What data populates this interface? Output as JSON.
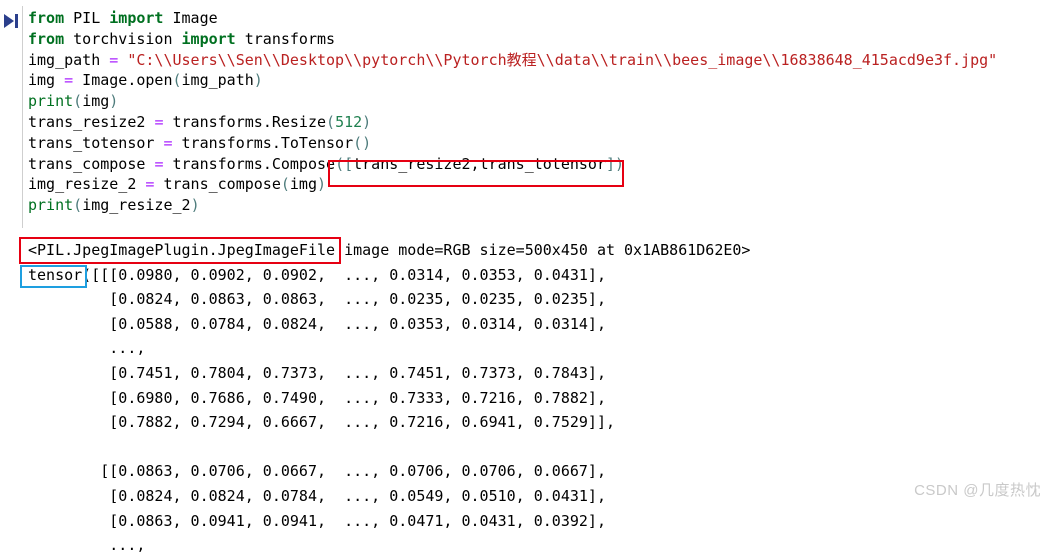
{
  "gutter": {
    "run_icon": "run-cell-icon"
  },
  "code": {
    "lines": [
      [
        {
          "t": "from",
          "c": "kw"
        },
        {
          "t": " PIL ",
          "c": "plain"
        },
        {
          "t": "import",
          "c": "kw"
        },
        {
          "t": " Image",
          "c": "plain"
        }
      ],
      [
        {
          "t": "from",
          "c": "kw"
        },
        {
          "t": " torchvision ",
          "c": "plain"
        },
        {
          "t": "import",
          "c": "kw"
        },
        {
          "t": " transforms",
          "c": "plain"
        }
      ],
      [
        {
          "t": "img_path ",
          "c": "plain"
        },
        {
          "t": "=",
          "c": "op"
        },
        {
          "t": " ",
          "c": "plain"
        },
        {
          "t": "\"C:\\\\Users\\\\Sen\\\\Desktop\\\\pytorch\\\\Pytorch教程\\\\data\\\\train\\\\bees_image\\\\16838648_415acd9e3f.jpg\"",
          "c": "str"
        }
      ],
      [
        {
          "t": "img ",
          "c": "plain"
        },
        {
          "t": "=",
          "c": "op"
        },
        {
          "t": " Image",
          "c": "plain"
        },
        {
          "t": ".",
          "c": "plain"
        },
        {
          "t": "open",
          "c": "plain"
        },
        {
          "t": "(",
          "c": "punc"
        },
        {
          "t": "img_path",
          "c": "plain"
        },
        {
          "t": ")",
          "c": "punc"
        }
      ],
      [
        {
          "t": "print",
          "c": "builtin"
        },
        {
          "t": "(",
          "c": "punc"
        },
        {
          "t": "img",
          "c": "plain"
        },
        {
          "t": ")",
          "c": "punc"
        }
      ],
      [
        {
          "t": "trans_resize2 ",
          "c": "plain"
        },
        {
          "t": "=",
          "c": "op"
        },
        {
          "t": " transforms",
          "c": "plain"
        },
        {
          "t": ".",
          "c": "plain"
        },
        {
          "t": "Resize",
          "c": "plain"
        },
        {
          "t": "(",
          "c": "punc"
        },
        {
          "t": "512",
          "c": "num"
        },
        {
          "t": ")",
          "c": "punc"
        }
      ],
      [
        {
          "t": "trans_totensor ",
          "c": "plain"
        },
        {
          "t": "=",
          "c": "op"
        },
        {
          "t": " transforms",
          "c": "plain"
        },
        {
          "t": ".",
          "c": "plain"
        },
        {
          "t": "ToTensor",
          "c": "plain"
        },
        {
          "t": "(",
          "c": "punc"
        },
        {
          "t": ")",
          "c": "punc"
        }
      ],
      [
        {
          "t": "trans_compose ",
          "c": "plain"
        },
        {
          "t": "=",
          "c": "op"
        },
        {
          "t": " transforms",
          "c": "plain"
        },
        {
          "t": ".",
          "c": "plain"
        },
        {
          "t": "Compose",
          "c": "plain"
        },
        {
          "t": "(",
          "c": "punc"
        },
        {
          "t": "[",
          "c": "punc"
        },
        {
          "t": "trans_resize2",
          "c": "plain"
        },
        {
          "t": ",",
          "c": "plain"
        },
        {
          "t": "trans_totensor",
          "c": "plain"
        },
        {
          "t": "]",
          "c": "punc"
        },
        {
          "t": ")",
          "c": "punc"
        }
      ],
      [
        {
          "t": "img_resize_2 ",
          "c": "plain"
        },
        {
          "t": "=",
          "c": "op"
        },
        {
          "t": " trans_compose",
          "c": "plain"
        },
        {
          "t": "(",
          "c": "punc"
        },
        {
          "t": "img",
          "c": "plain"
        },
        {
          "t": ")",
          "c": "punc"
        }
      ],
      [
        {
          "t": "print",
          "c": "builtin"
        },
        {
          "t": "(",
          "c": "punc"
        },
        {
          "t": "img_resize_2",
          "c": "plain"
        },
        {
          "t": ")",
          "c": "punc"
        }
      ]
    ]
  },
  "output": {
    "lines": [
      "<PIL.JpegImagePlugin.JpegImageFile image mode=RGB size=500x450 at 0x1AB861D62E0>",
      "tensor([[[0.0980, 0.0902, 0.0902,  ..., 0.0314, 0.0353, 0.0431],",
      "         [0.0824, 0.0863, 0.0863,  ..., 0.0235, 0.0235, 0.0235],",
      "         [0.0588, 0.0784, 0.0824,  ..., 0.0353, 0.0314, 0.0314],",
      "         ...,",
      "         [0.7451, 0.7804, 0.7373,  ..., 0.7451, 0.7373, 0.7843],",
      "         [0.6980, 0.7686, 0.7490,  ..., 0.7333, 0.7216, 0.7882],",
      "         [0.7882, 0.7294, 0.6667,  ..., 0.7216, 0.6941, 0.7529]],",
      "",
      "        [[0.0863, 0.0706, 0.0667,  ..., 0.0706, 0.0706, 0.0667],",
      "         [0.0824, 0.0824, 0.0784,  ..., 0.0549, 0.0510, 0.0431],",
      "         [0.0863, 0.0941, 0.0941,  ..., 0.0471, 0.0431, 0.0392],",
      "         ...,"
    ]
  },
  "annotations": {
    "compose_box": {
      "label": "([trans_resize2,trans_totensor])",
      "color": "#e60012"
    },
    "pil_box": {
      "label": "<PIL.JpegImagePlugin.JpegImageFile",
      "color": "#e60012"
    },
    "tensor_box": {
      "label": "tensor",
      "color": "#1e9fe0"
    }
  },
  "watermark": {
    "text": "CSDN @几度热忱"
  }
}
